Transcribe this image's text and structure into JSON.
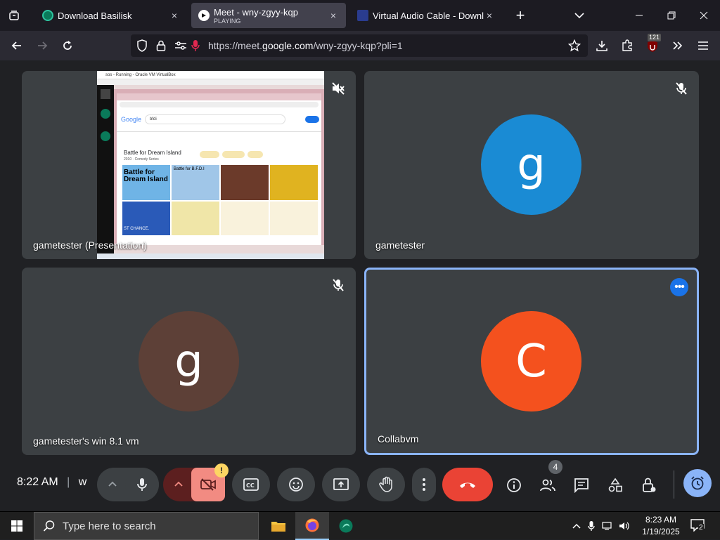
{
  "browser": {
    "tabs": [
      {
        "title": "Download Basilisk",
        "close": "×"
      },
      {
        "title": "Meet - wny-zgyy-kqp",
        "status": "PLAYING",
        "close": "×"
      },
      {
        "title": "Virtual Audio Cable - Downloa",
        "close": "×"
      }
    ],
    "new_tab": "+",
    "url_prefix": "https://meet.",
    "url_domain": "google.com",
    "url_path": "/wny-zgyy-kqp?pli=1",
    "notification_badge": "121"
  },
  "meet": {
    "tiles": [
      {
        "name": "gametester (Presentation)"
      },
      {
        "name": "gametester",
        "initial": "g",
        "color": "#1a8bd4"
      },
      {
        "name": "gametester's win 8.1 vm",
        "initial": "g",
        "color": "#5d4037"
      },
      {
        "name": "Collabvm",
        "initial": "C",
        "color": "#f4511e"
      }
    ],
    "more_options": "•••",
    "clock": "8:22 AM",
    "meeting_code_partial": "w",
    "camera_warning": "!",
    "participants_count": "4"
  },
  "presentation": {
    "window_title": "sos - Running - Oracle VM VirtualBox",
    "search_query": "bfdi",
    "result_title": "Battle for Dream Island",
    "result_sub": "2010 · Comedy Series",
    "logo_text": "Google",
    "thumb1_text": "Battle for Dream Island",
    "thumb2_text": "Battle for B.F.D.I",
    "thumb3_text": "ST CHANCE."
  },
  "taskbar": {
    "search_placeholder": "Type here to search",
    "time": "8:23 AM",
    "date": "1/19/2025",
    "notifications": "2"
  },
  "colors": {
    "meet_bg": "#202124",
    "tile_bg": "#3c4043",
    "end_call": "#ea4335",
    "camera_off": "#f28b82",
    "active_blue": "#8ab4f8"
  }
}
